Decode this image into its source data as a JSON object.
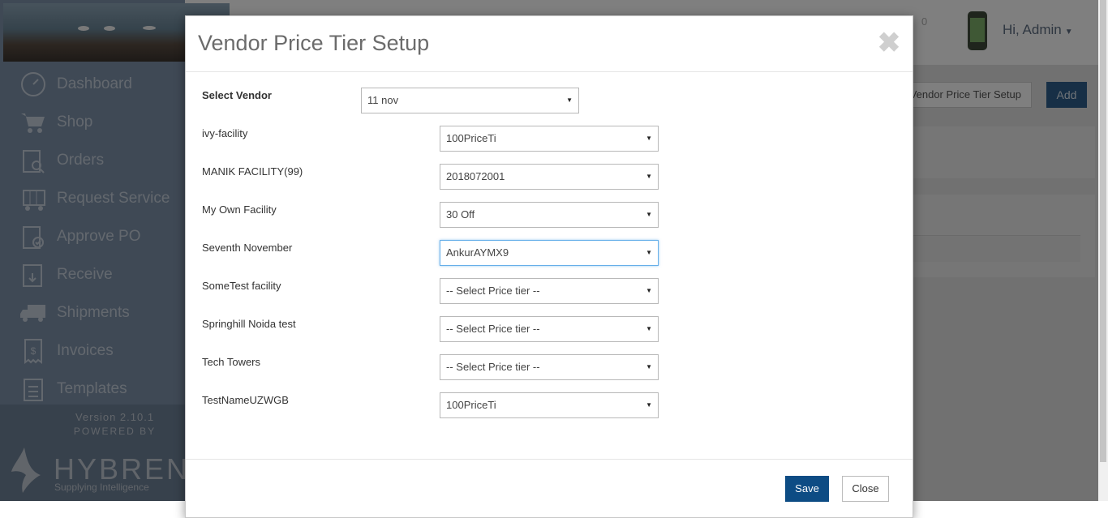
{
  "sidebar": {
    "items": [
      {
        "label": "Dashboard",
        "icon": "dashboard-gauge-icon"
      },
      {
        "label": "Shop",
        "icon": "shopping-cart-icon"
      },
      {
        "label": "Orders",
        "icon": "orders-clipboard-search-icon"
      },
      {
        "label": "Request Service",
        "icon": "service-cart-icon"
      },
      {
        "label": "Approve PO",
        "icon": "approve-clipboard-icon"
      },
      {
        "label": "Receive",
        "icon": "receive-clipboard-icon"
      },
      {
        "label": "Shipments",
        "icon": "truck-icon"
      },
      {
        "label": "Invoices",
        "icon": "invoice-receipt-icon"
      },
      {
        "label": "Templates",
        "icon": "template-clipboard-icon"
      }
    ],
    "version": "Version 2.10.1",
    "powered_by": "POWERED BY",
    "brand": "HYBREN",
    "tagline": "Supplying Intelligence"
  },
  "header": {
    "greeting": "Hi, Admin",
    "notification_count": "0"
  },
  "page": {
    "breadcrumb": "Vendor Price Tier Setup",
    "add_label": "Add"
  },
  "modal": {
    "title": "Vendor Price Tier Setup",
    "close_symbol": "✖",
    "vendor_label": "Select Vendor",
    "vendor_value": "11 nov",
    "facilities": [
      {
        "name": "ivy-facility",
        "tier": "100PriceTi"
      },
      {
        "name": "MANIK FACILITY(99)",
        "tier": "2018072001"
      },
      {
        "name": "My Own Facility",
        "tier": "30 Off"
      },
      {
        "name": "Seventh November",
        "tier": "AnkurAYMX9"
      },
      {
        "name": "SomeTest facility",
        "tier": "-- Select Price tier --"
      },
      {
        "name": "Springhill Noida test",
        "tier": "-- Select Price tier --"
      },
      {
        "name": "Tech Towers",
        "tier": "-- Select Price tier --"
      },
      {
        "name": "TestNameUZWGB",
        "tier": "100PriceTi"
      }
    ],
    "save_label": "Save",
    "close_label": "Close"
  },
  "colors": {
    "primary": "#0d4c84",
    "sidebar": "#7f93ab",
    "focus": "#66afe9"
  }
}
